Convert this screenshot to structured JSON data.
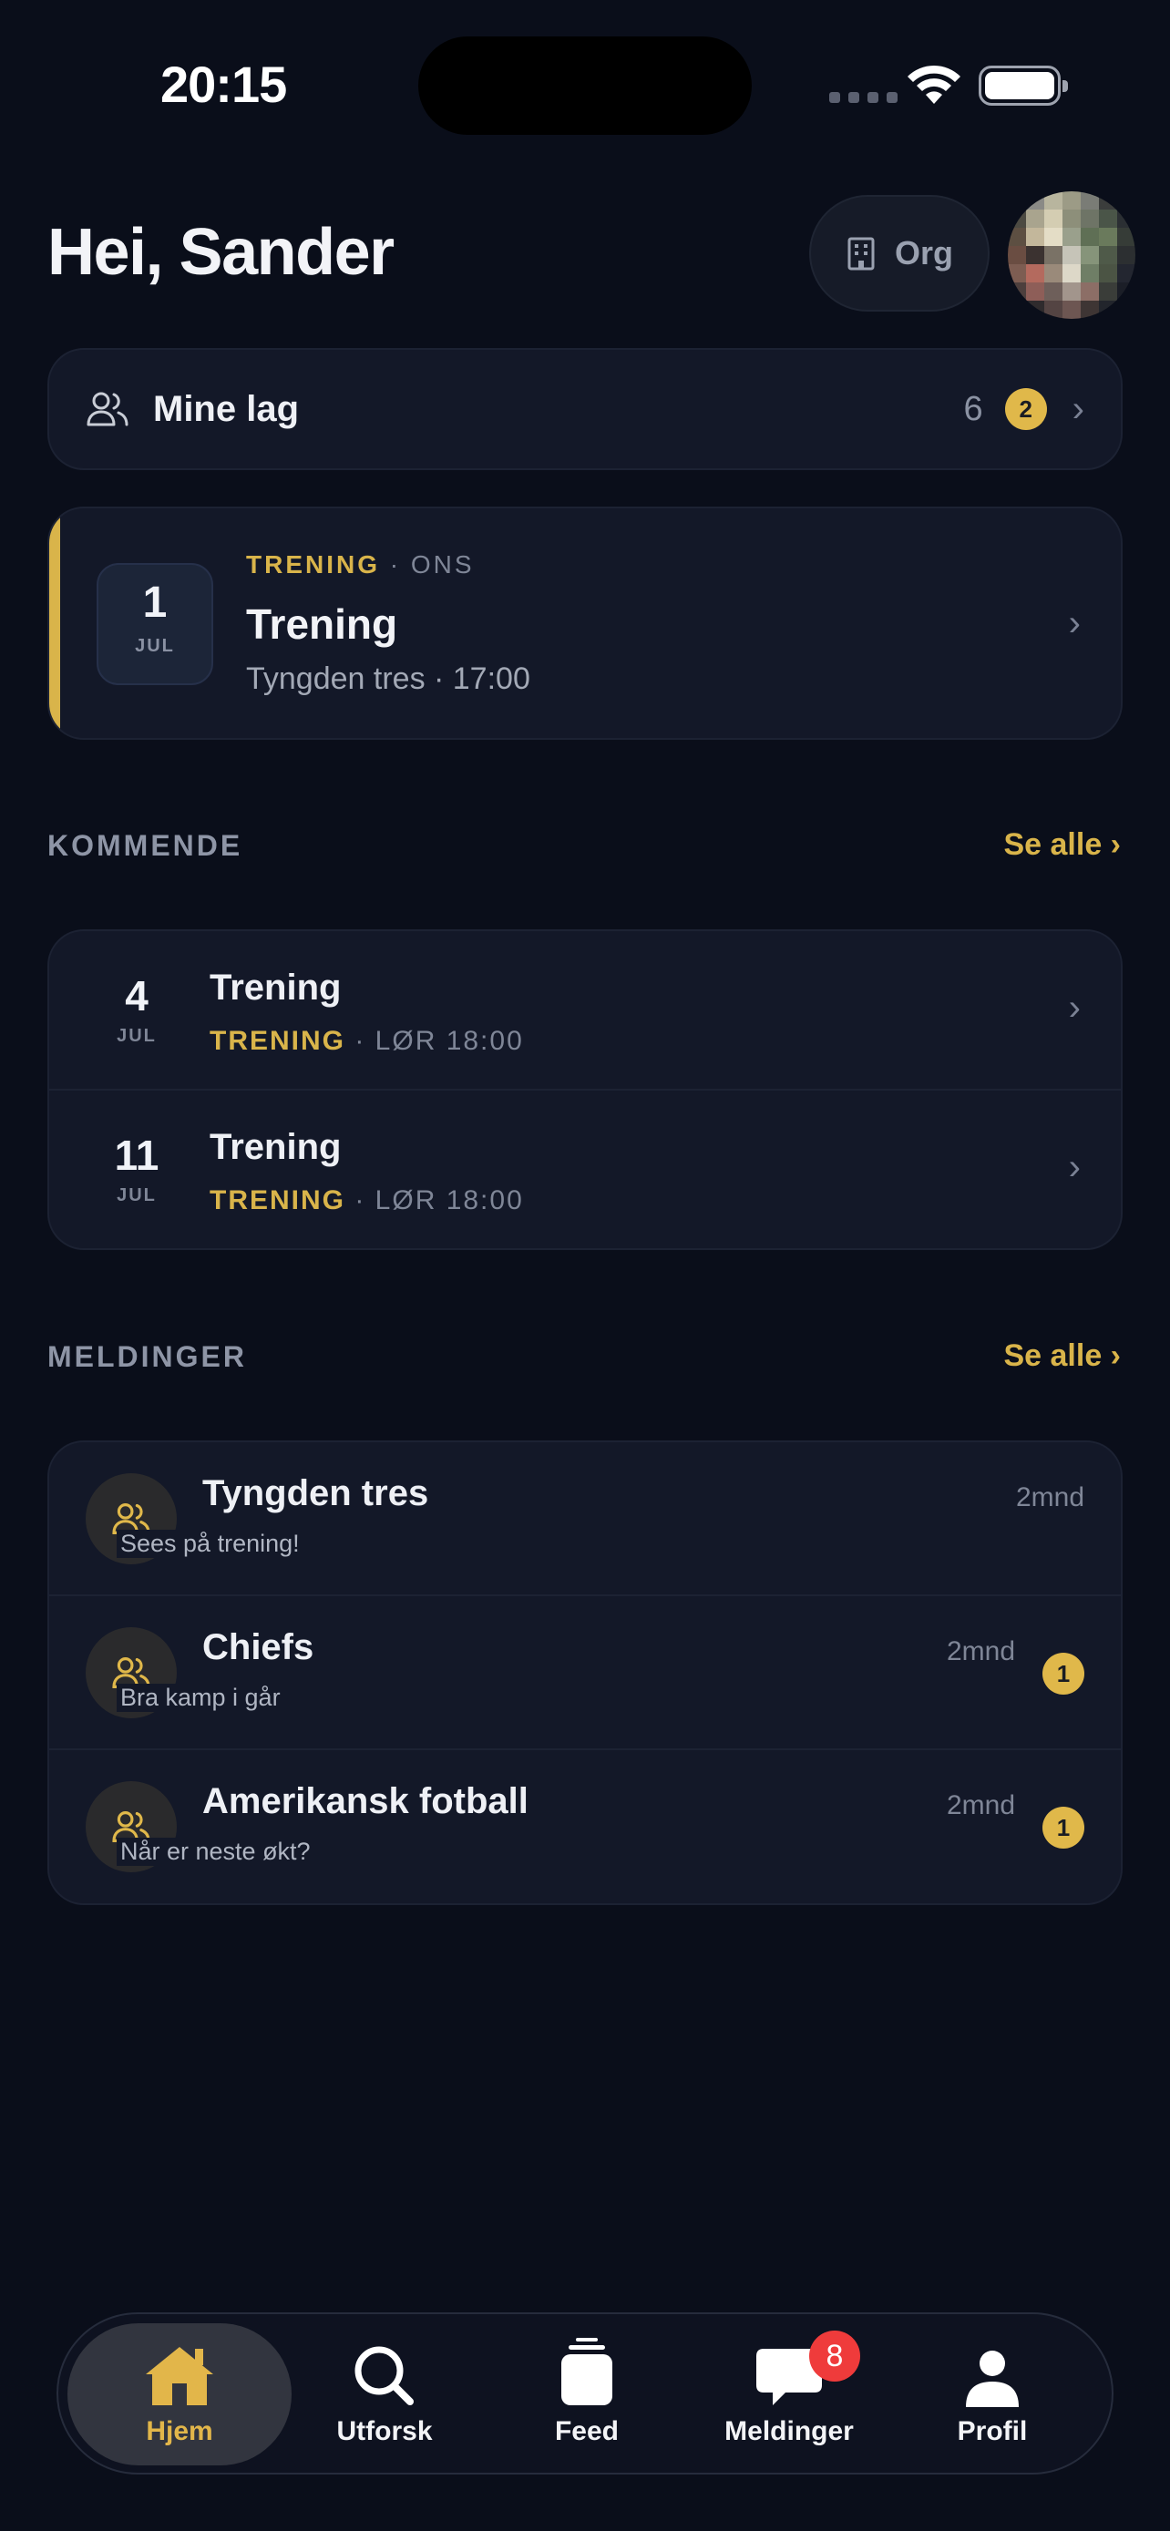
{
  "status_bar": {
    "time": "20:15"
  },
  "header": {
    "greeting": "Hei, Sander",
    "org_label": "Org"
  },
  "teams": {
    "label": "Mine lag",
    "count": "6",
    "badge": "2"
  },
  "next_event": {
    "day": "1",
    "month": "JUL",
    "category": "TRENING",
    "weekday": "ONS",
    "title": "Trening",
    "subtitle": "Tyngden tres · 17:00"
  },
  "upcoming": {
    "label": "KOMMENDE",
    "see_all": "Se alle ›",
    "items": [
      {
        "day": "4",
        "month": "JUL",
        "title": "Trening",
        "category": "TRENING",
        "time": "LØR 18:00"
      },
      {
        "day": "11",
        "month": "JUL",
        "title": "Trening",
        "category": "TRENING",
        "time": "LØR 18:00"
      }
    ]
  },
  "messages": {
    "label": "MELDINGER",
    "see_all": "Se alle ›",
    "items": [
      {
        "name": "Tyngden tres",
        "preview": "Sees på trening!",
        "time": "2mnd",
        "unread": ""
      },
      {
        "name": "Chiefs",
        "preview": "Bra kamp i går",
        "time": "2mnd",
        "unread": "1"
      },
      {
        "name": "Amerikansk fotball",
        "preview": "Når er neste økt?",
        "time": "2mnd",
        "unread": "1"
      }
    ]
  },
  "tabbar": {
    "items": [
      {
        "label": "Hjem",
        "icon": "home-icon",
        "active": true
      },
      {
        "label": "Utforsk",
        "icon": "search-icon",
        "active": false
      },
      {
        "label": "Feed",
        "icon": "feed-icon",
        "active": false
      },
      {
        "label": "Meldinger",
        "icon": "chat-icon",
        "active": false,
        "badge": "8"
      },
      {
        "label": "Profil",
        "icon": "person-icon",
        "active": false
      }
    ]
  },
  "colors": {
    "accent": "#d9b44a",
    "background": "#0a0e1a",
    "card": "#131828",
    "badge_red": "#ef3b3b"
  }
}
